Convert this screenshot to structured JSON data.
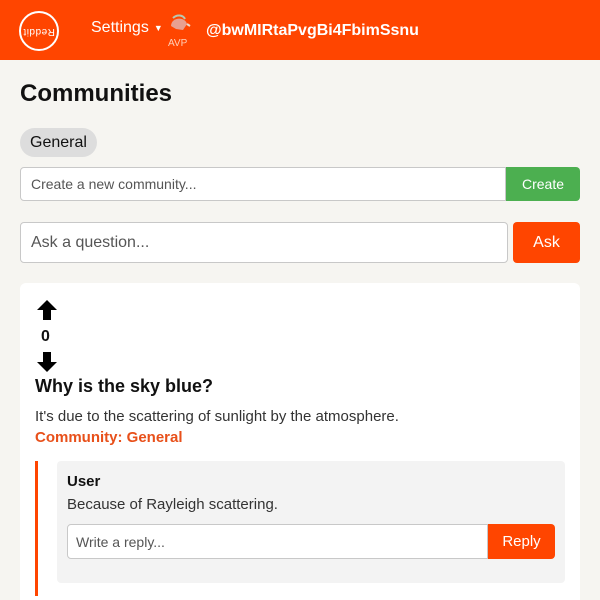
{
  "header": {
    "logo_text": "Reddit",
    "settings_label": "Settings",
    "avatar_text": "AVP",
    "username": "@bwMIRtaPvgBi4FbimSsnu"
  },
  "page": {
    "title": "Communities",
    "selected_community": "General"
  },
  "create_community": {
    "placeholder": "Create a new community...",
    "button_label": "Create"
  },
  "ask": {
    "placeholder": "Ask a question...",
    "button_label": "Ask"
  },
  "question": {
    "votes": "0",
    "title": "Why is the sky blue?",
    "body": "It's due to the scattering of sunlight by the atmosphere.",
    "community_label": "Community: General",
    "answers": [
      {
        "author": "User",
        "text": "Because of Rayleigh scattering.",
        "reply_placeholder": "Write a reply...",
        "reply_button": "Reply"
      }
    ]
  },
  "colors": {
    "brand": "#ff4500",
    "create_button": "#4caf50",
    "community_link": "#e8501a",
    "background": "#f6f5f1"
  },
  "icons": [
    "logo-icon",
    "chevron-down-icon",
    "avatar-icon",
    "arrow-up-icon",
    "arrow-down-icon"
  ]
}
